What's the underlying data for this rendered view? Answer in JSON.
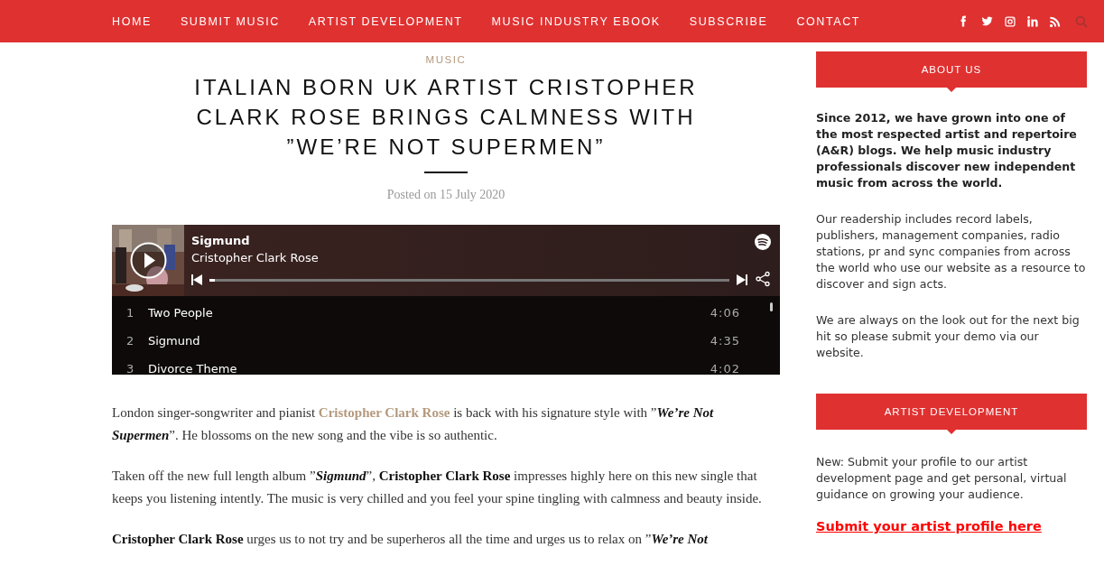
{
  "nav": {
    "items": [
      "HOME",
      "SUBMIT MUSIC",
      "ARTIST DEVELOPMENT",
      "MUSIC INDUSTRY EBOOK",
      "SUBSCRIBE",
      "CONTACT"
    ]
  },
  "post": {
    "category": "MUSIC",
    "title": "ITALIAN BORN UK ARTIST CRISTOPHER CLARK ROSE BRINGS CALMNESS WITH ”WE’RE NOT SUPERMEN”",
    "posted": "Posted on 15 July 2020",
    "player": {
      "level": 0.01,
      "track": "Sigmund",
      "artist": "Cristopher Clark Rose",
      "tracks": [
        {
          "number": "1",
          "title": "Two People",
          "duration": "4:06"
        },
        {
          "number": "2",
          "title": "Sigmund",
          "duration": "4:35"
        },
        {
          "number": "3",
          "title": "Divorce Theme",
          "duration": "4:02"
        }
      ]
    },
    "paragraphs": [
      [
        {
          "kind": "plain",
          "text": "London singer-songwriter and pianist "
        },
        {
          "kind": "link",
          "text": "Cristopher Clark Rose"
        },
        {
          "kind": "plain",
          "text": " is back with his signature style with ”"
        },
        {
          "kind": "bolditalic",
          "text": "We’re Not Supermen"
        },
        {
          "kind": "plain",
          "text": "”. He blossoms on the new song and the vibe is so authentic."
        }
      ],
      [
        {
          "kind": "plain",
          "text": "Taken off the new full length album ”"
        },
        {
          "kind": "bolditalic",
          "text": "Sigmund"
        },
        {
          "kind": "plain",
          "text": "”, "
        },
        {
          "kind": "bold",
          "text": "Cristopher Clark Rose"
        },
        {
          "kind": "plain",
          "text": " impresses highly here on this new single that keeps you listening intently. The music is very chilled and you feel your spine tingling with calmness and beauty inside."
        }
      ],
      [
        {
          "kind": "bold",
          "text": "Cristopher Clark Rose"
        },
        {
          "kind": "plain",
          "text": " urges us to not try and be superheros all the time and urges us to relax on ”"
        },
        {
          "kind": "bolditalic",
          "text": "We’re Not"
        }
      ]
    ]
  },
  "sidebar": [
    {
      "heading": "ABOUT US",
      "blocks": [
        {
          "kind": "lead",
          "text": "Since 2012, we have grown into one of the most respected artist and repertoire (A&R) blogs. We help music industry professionals discover new independent music from across the world."
        },
        {
          "kind": "text",
          "text": "Our readership includes record labels, publishers, management companies, radio stations, pr and sync companies from across the world who use our website as a resource to discover and sign acts."
        },
        {
          "kind": "text",
          "text": "We are always on the look out for the next big hit so please submit your demo via our website."
        }
      ]
    },
    {
      "heading": "ARTIST DEVELOPMENT",
      "blocks": [
        {
          "kind": "text",
          "text": "New: Submit your profile to our artist development page and get personal, virtual guidance on growing your audience."
        },
        {
          "kind": "link",
          "text": "Submit your artist profile here"
        }
      ]
    }
  ]
}
